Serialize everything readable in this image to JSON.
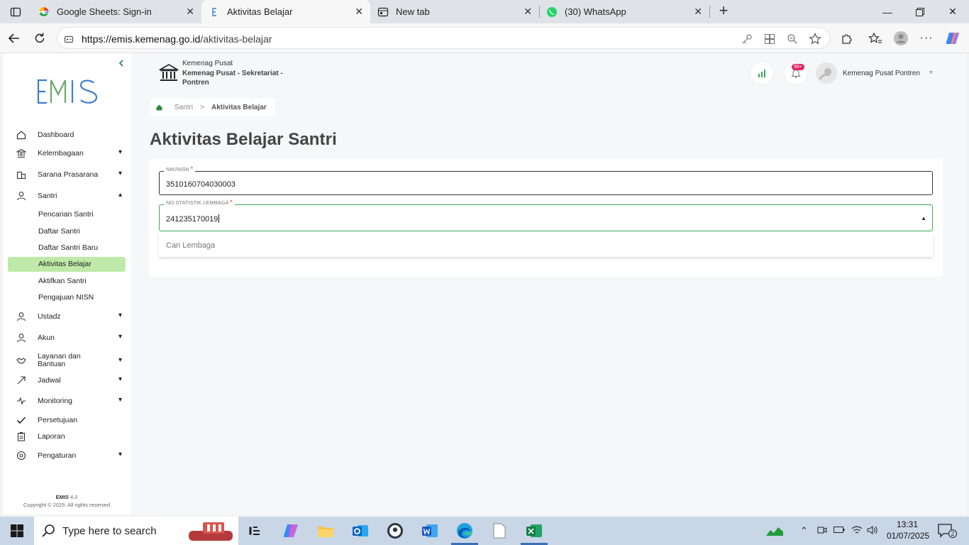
{
  "browser": {
    "tabs": [
      {
        "title": "Google Sheets: Sign-in",
        "active": false
      },
      {
        "title": "Aktivitas Belajar",
        "active": true
      },
      {
        "title": "New tab",
        "active": false
      },
      {
        "title": "(30) WhatsApp",
        "active": false
      }
    ],
    "url_host": "https://emis.kemenag.go.id",
    "url_path": "/aktivitas-belajar"
  },
  "sidebar": {
    "logo": "EMIS",
    "items": [
      {
        "label": "Dashboard",
        "icon": "home-icon",
        "expandable": false
      },
      {
        "label": "Kelembagaan",
        "icon": "institution-icon",
        "expandable": true
      },
      {
        "label": "Sarana Prasarana",
        "icon": "building-icon",
        "expandable": true
      },
      {
        "label": "Santri",
        "icon": "user-icon",
        "expandable": true,
        "expanded": true
      },
      {
        "label": "Ustadz",
        "icon": "user-icon",
        "expandable": true
      },
      {
        "label": "Akun",
        "icon": "user-icon",
        "expandable": true
      },
      {
        "label": "Layanan dan Bantuan",
        "icon": "handshake-icon",
        "expandable": true
      },
      {
        "label": "Jadwal",
        "icon": "calendar-icon",
        "expandable": true
      },
      {
        "label": "Monitoring",
        "icon": "monitor-icon",
        "expandable": true
      },
      {
        "label": "Persetujuan",
        "icon": "check-icon",
        "expandable": false
      },
      {
        "label": "Laporan",
        "icon": "clipboard-icon",
        "expandable": false
      },
      {
        "label": "Pengaturan",
        "icon": "settings-icon",
        "expandable": true
      }
    ],
    "santri_sub": [
      "Pencarian Santri",
      "Daftar Santri",
      "Daftar Santri Baru",
      "Aktivitas Belajar",
      "Aktifkan Santri",
      "Pengajuan NISN"
    ],
    "active_sub": "Aktivitas Belajar",
    "footer_name": "EMIS",
    "footer_version": "4.0",
    "footer_copyright": "Copyright © 2025. All rights reserved"
  },
  "header": {
    "institution_line1": "Kemenag Pusat",
    "institution_line2a": "Kemenag Pusat - Sekretariat -",
    "institution_line2b": "Pontren",
    "notification_badge": "99+",
    "user_name": "Kemenag Pusat Pontren"
  },
  "breadcrumb": {
    "parent": "Santri",
    "separator": ">",
    "current": "Aktivitas Belajar"
  },
  "main": {
    "title": "Aktivitas Belajar Santri",
    "field_nik": {
      "label": "NIK/NISN",
      "required_mark": "*",
      "value": "3510160704030003"
    },
    "field_nsl": {
      "label": "NO STATISTIK LEMBAGA",
      "required_mark": "*",
      "value": "241235170019"
    },
    "dropdown_option": "Cari Lembaga"
  },
  "taskbar": {
    "search_placeholder": "Type here to search",
    "time": "13:31",
    "date": "01/07/2025",
    "notification_count": "2"
  },
  "colors": {
    "accent_green": "#3aa857",
    "active_menu_bg": "#bfe9a8",
    "logo_blue": "#3d7ecf"
  }
}
